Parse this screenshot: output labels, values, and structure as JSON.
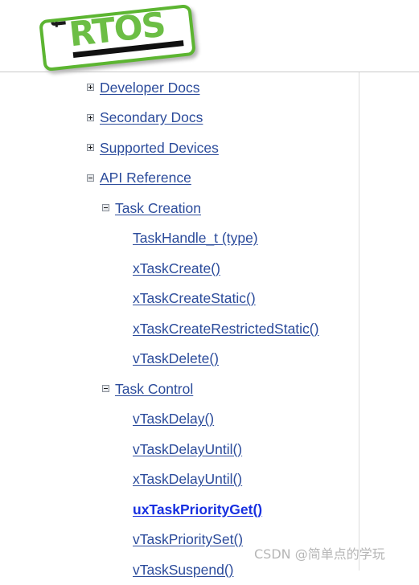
{
  "logo": {
    "free_text": "free",
    "rtos_text": "RTOS",
    "green": "#6cbe45",
    "border_green": "#5cb531",
    "bar_color": "#111111"
  },
  "colors": {
    "link": "#2b4b9b",
    "active_link": "#1830e0",
    "rule": "#c8c8c8",
    "divider": "#dcdcdc",
    "watermark": "#b6b6b6"
  },
  "tree": {
    "items": [
      {
        "label": "Developer Docs",
        "level": 0,
        "toggle": "plus",
        "active": false
      },
      {
        "label": "Secondary Docs",
        "level": 0,
        "toggle": "plus",
        "active": false
      },
      {
        "label": "Supported Devices",
        "level": 0,
        "toggle": "plus",
        "active": false
      },
      {
        "label": "API Reference",
        "level": 0,
        "toggle": "minus",
        "active": false
      },
      {
        "label": "Task Creation",
        "level": 1,
        "toggle": "minus",
        "active": false
      },
      {
        "label": "TaskHandle_t (type)",
        "level": 2,
        "toggle": "none",
        "active": false
      },
      {
        "label": "xTaskCreate()",
        "level": 2,
        "toggle": "none",
        "active": false
      },
      {
        "label": "xTaskCreateStatic()",
        "level": 2,
        "toggle": "none",
        "active": false
      },
      {
        "label": "xTaskCreateRestrictedStatic()",
        "level": 2,
        "toggle": "none",
        "active": false
      },
      {
        "label": "vTaskDelete()",
        "level": 2,
        "toggle": "none",
        "active": false
      },
      {
        "label": "Task Control",
        "level": 1,
        "toggle": "minus",
        "active": false
      },
      {
        "label": "vTaskDelay()",
        "level": 2,
        "toggle": "none",
        "active": false
      },
      {
        "label": "vTaskDelayUntil()",
        "level": 2,
        "toggle": "none",
        "active": false
      },
      {
        "label": "xTaskDelayUntil()",
        "level": 2,
        "toggle": "none",
        "active": false
      },
      {
        "label": "uxTaskPriorityGet()",
        "level": 2,
        "toggle": "none",
        "active": true
      },
      {
        "label": "vTaskPrioritySet()",
        "level": 2,
        "toggle": "none",
        "active": false
      },
      {
        "label": "vTaskSuspend()",
        "level": 2,
        "toggle": "none",
        "active": false
      }
    ]
  },
  "watermark": {
    "text": "CSDN @简单点的学玩"
  }
}
